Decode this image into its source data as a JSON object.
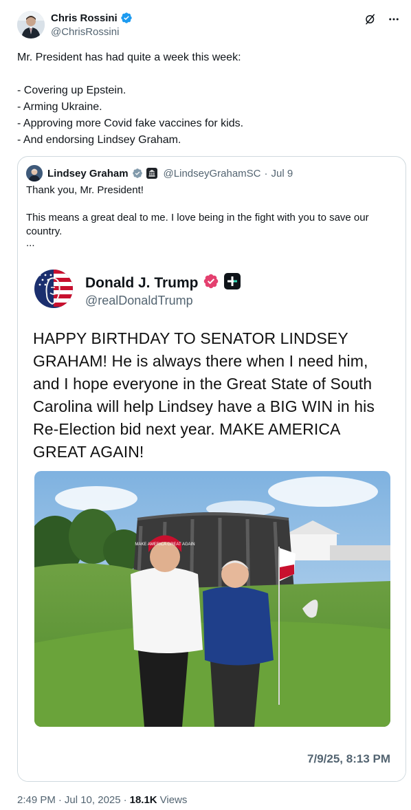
{
  "author": {
    "name": "Chris Rossini",
    "handle": "@ChrisRossini",
    "verified_icon": "verified-badge-icon",
    "verified_color": "#1d9bf0"
  },
  "header_actions": {
    "grok_icon": "grok-icon",
    "more_icon": "more-icon"
  },
  "tweet": {
    "lines": [
      "Mr. President has had quite a week this week:",
      "- Covering up Epstein.",
      "- Arming Ukraine.",
      "- Approving more Covid fake vaccines for kids.",
      "- And endorsing Lindsey Graham."
    ]
  },
  "quote": {
    "name": "Lindsey Graham",
    "handle": "@LindseyGrahamSC",
    "separator": "·",
    "date": "Jul 9",
    "badge_color": "#829aab",
    "text_line1": "Thank you, Mr. President!",
    "text_line2": "This means a great deal to me. I love being in the fight with you to save our country.",
    "text_ellipsis": "..."
  },
  "embedded_post": {
    "name": "Donald J. Trump",
    "handle": "@realDonaldTrump",
    "verified_color": "#e4406f",
    "platform_icon": "truth-social-plus-icon",
    "body": "HAPPY BIRTHDAY TO SENATOR LINDSEY GRAHAM! He is always there when I need him, and I hope everyone in the Great State of South Carolina will help Lindsey have a BIG WIN in his Re-Election bid next year. MAKE AMERICA GREAT AGAIN!",
    "timestamp": "7/9/25, 8:13 PM",
    "photo_description_icon": "golf-course-photo",
    "hat_text": "MAKE AMERICA GREAT AGAIN"
  },
  "footer": {
    "time": "2:49 PM",
    "sep1": "·",
    "date": "Jul 10, 2025",
    "sep2": "·",
    "views_count": "18.1K",
    "views_label": "Views"
  }
}
